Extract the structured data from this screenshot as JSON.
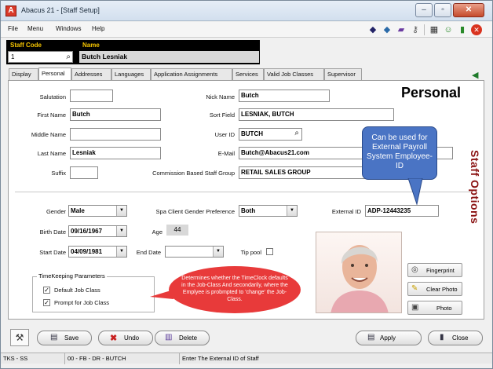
{
  "window": {
    "title": "Abacus 21 - [Staff Setup]"
  },
  "menu": [
    "File",
    "Menu",
    "Windows",
    "Help"
  ],
  "header": {
    "staff_code_label": "Staff Code",
    "staff_code_value": "1",
    "name_label": "Name",
    "name_value": "Butch  Lesniak"
  },
  "tabs": [
    "Display",
    "Personal",
    "Addresses",
    "Languages",
    "Application Assignments",
    "Services",
    "Valid Job Classes",
    "Supervisor"
  ],
  "active_tab": "Personal",
  "form": {
    "heading": "Personal",
    "salutation_label": "Salutation",
    "salutation_value": "",
    "first_name_label": "First Name",
    "first_name_value": "Butch",
    "middle_name_label": "Middle Name",
    "middle_name_value": "",
    "last_name_label": "Last Name",
    "last_name_value": "Lesniak",
    "suffix_label": "Suffix",
    "suffix_value": "",
    "nick_name_label": "Nick Name",
    "nick_name_value": "Butch",
    "sort_field_label": "Sort Field",
    "sort_field_value": "LESNIAK, BUTCH",
    "user_id_label": "User ID",
    "user_id_value": "BUTCH",
    "email_label": "E-Mail",
    "email_value": "Butch@Abacus21.com",
    "commission_label": "Commission Based Staff Group",
    "commission_value": "RETAIL SALES GROUP",
    "gender_label": "Gender",
    "gender_value": "Male",
    "spa_pref_label": "Spa Client Gender Preference",
    "spa_pref_value": "Both",
    "external_id_label": "External ID",
    "external_id_value": "ADP-12443235",
    "birth_date_label": "Birth Date",
    "birth_date_value": "09/16/1967",
    "age_label": "Age",
    "age_value": "44",
    "start_date_label": "Start Date",
    "start_date_value": "04/09/1981",
    "end_date_label": "End Date",
    "end_date_value": "",
    "tip_pool_label": "Tip pool",
    "timekeeping_label": "TimeKeeping Parameters",
    "default_job_class_label": "Default Job Class",
    "prompt_job_class_label": "Prompt for Job Class"
  },
  "side_label": "Staff Options",
  "callouts": {
    "external": "Can be used for External Payroll System Employee-ID",
    "timeclock": "Determines whether the TimeClock defaults in the Job-Class  And secondarily, where the Emplyee is probmpted to 'change' the Job-Class."
  },
  "buttons": {
    "fingerprint": "Fingerprint",
    "clear_photo": "Clear Photo",
    "photo": "Photo",
    "save": "Save",
    "undo": "Undo",
    "delete": "Delete",
    "apply": "Apply",
    "close": "Close"
  },
  "status": {
    "left": "TKS - SS",
    "middle": "00 - FB - DR - BUTCH",
    "message": "Enter The External ID of Staff"
  },
  "colors": {
    "heading_red": "#8a1212",
    "callout_blue": "#4a74c4",
    "callout_red": "#e83a3a",
    "label_yellow": "#f7c600"
  }
}
